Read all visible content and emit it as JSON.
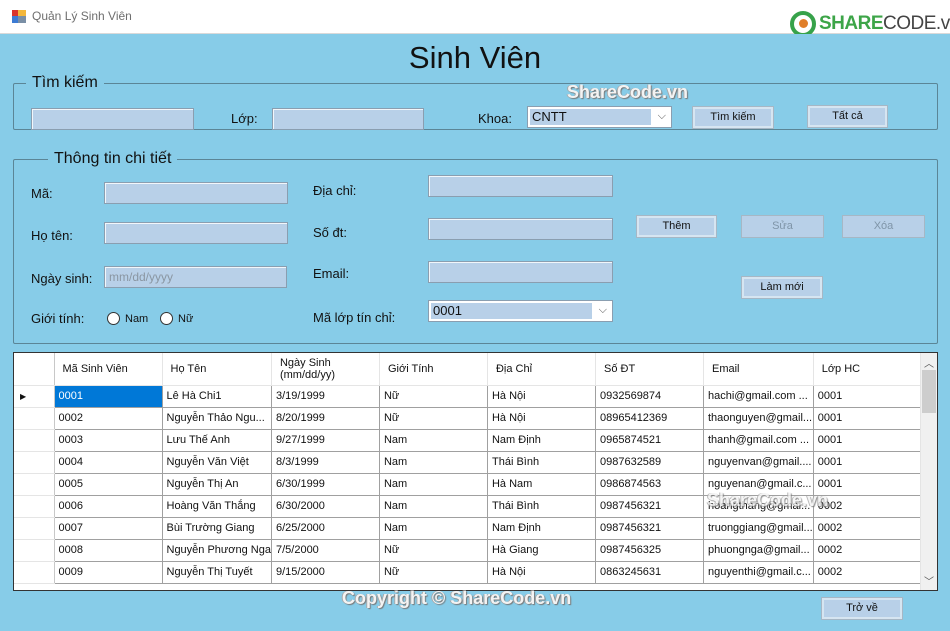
{
  "window": {
    "title": "Quản Lý Sinh Viên",
    "logo_part1": "SHARE",
    "logo_part2": "CODE.vn",
    "controls": [
      "—",
      "☐",
      "✕"
    ]
  },
  "heading": "Sinh Viên",
  "search": {
    "legend": "Tìm kiếm",
    "name_value": "",
    "class_label": "Lớp:",
    "class_value": "",
    "faculty_label": "Khoa:",
    "faculty_selected": "CNTT",
    "search_button": "Tìm kiếm",
    "all_button": "Tất cả"
  },
  "details": {
    "legend": "Thông tin chi tiết",
    "id_label": "Mã:",
    "id_value": "",
    "name_label": "Họ tên:",
    "name_value": "",
    "dob_label": "Ngày sinh:",
    "dob_placeholder": "mm/dd/yyyy",
    "gender_label": "Giới tính:",
    "gender_options": [
      "Nam",
      "Nữ"
    ],
    "address_label": "Địa chỉ:",
    "address_value": "",
    "phone_label": "Số đt:",
    "phone_value": "",
    "email_label": "Email:",
    "email_value": "",
    "credit_class_label": "Mã lớp tín chỉ:",
    "credit_class_selected": "0001",
    "add_button": "Thêm",
    "edit_button": "Sửa",
    "delete_button": "Xóa",
    "refresh_button": "Làm mới"
  },
  "table": {
    "columns": [
      "Mã Sinh Viên",
      "Họ Tên",
      "Ngày Sinh\n(mm/dd/yy)",
      "Giới Tính",
      "Địa Chỉ",
      "Số ĐT",
      "Email",
      "Lớp HC"
    ],
    "rows": [
      [
        "0001",
        "Lê Hà Chi1",
        "3/19/1999",
        "Nữ",
        "Hà Nội",
        "0932569874",
        "hachi@gmail.com   ...",
        "0001"
      ],
      [
        "0002",
        "Nguyễn Thảo Ngu...",
        "8/20/1999",
        "Nữ",
        "Hà Nội",
        "08965412369",
        "thaonguyen@gmail...",
        "0001"
      ],
      [
        "0003",
        "Lưu Thế Anh",
        "9/27/1999",
        "Nam",
        "Nam Định",
        "0965874521",
        "thanh@gmail.com   ...",
        "0001"
      ],
      [
        "0004",
        "Nguyễn Văn Việt",
        "8/3/1999",
        "Nam",
        "Thái Bình",
        "0987632589",
        "nguyenvan@gmail....",
        "0001"
      ],
      [
        "0005",
        "Nguyễn Thị An",
        "6/30/1999",
        "Nam",
        "Hà Nam",
        "0986874563",
        "nguyenan@gmail.c...",
        "0001"
      ],
      [
        "0006",
        "Hoàng Văn Thắng",
        "6/30/2000",
        "Nam",
        "Thái Bình",
        "0987456321",
        "hoangthang@gmai...",
        "0002"
      ],
      [
        "0007",
        "Bùi Trường Giang",
        "6/25/2000",
        "Nam",
        "Nam Định",
        "0987456321",
        "truonggiang@gmail...",
        "0002"
      ],
      [
        "0008",
        "Nguyễn Phương Nga",
        "7/5/2000",
        "Nữ",
        "Hà Giang",
        "0987456325",
        "phuongnga@gmail...",
        "0002"
      ],
      [
        "0009",
        "Nguyễn Thị Tuyết",
        "9/15/2000",
        "Nữ",
        "Hà Nội",
        "0863245631",
        "nguyenthi@gmail.c...",
        "0002"
      ]
    ],
    "selected_row": 0
  },
  "back_button": "Trở về",
  "watermarks": [
    "ShareCode.vn",
    "ShareCode.vn",
    "Copyright © ShareCode.vn"
  ]
}
